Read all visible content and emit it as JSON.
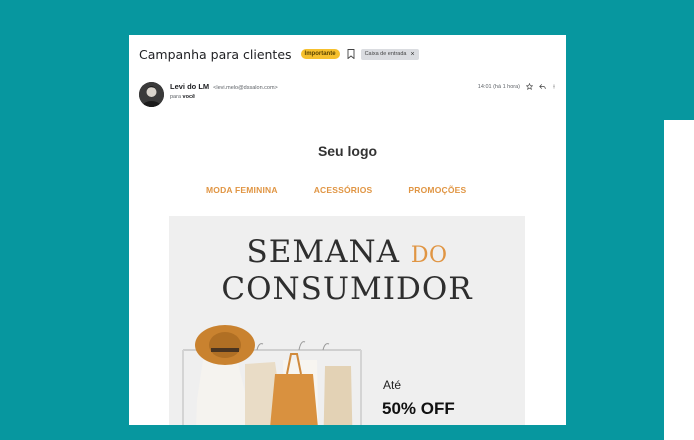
{
  "email": {
    "subject": "Campanha para clientes",
    "labels": {
      "important": "Importante",
      "inbox": "Caixa de entrada",
      "inbox_remove": "×"
    },
    "sender": {
      "name": "Levi do LM",
      "email": "<levi.melo@dssalon.com>",
      "to_prefix": "para",
      "to_name": "você"
    },
    "timestamp": "14:01 (há 1 hora)"
  },
  "newsletter": {
    "logo": "Seu logo",
    "nav": [
      "MODA FEMININA",
      "ACESSÓRIOS",
      "PROMOÇÕES"
    ],
    "hero": {
      "line1_main": "SEMANA",
      "line1_accent": "DO",
      "line2": "CONSUMIDOR",
      "promo_prefix": "Até",
      "promo_value": "50% OFF"
    }
  },
  "colors": {
    "background": "#07979f",
    "important_badge": "#f6c02d",
    "accent": "#e09543"
  },
  "icons": [
    "bookmark-icon",
    "star-icon",
    "reply-icon",
    "more-vert-icon"
  ]
}
